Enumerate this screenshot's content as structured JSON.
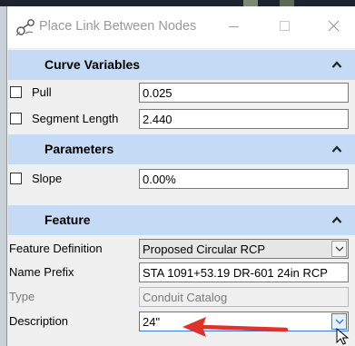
{
  "window": {
    "title": "Place Link Between Nodes"
  },
  "sections": {
    "curve": {
      "title": "Curve Variables",
      "rows": [
        {
          "label": "Pull",
          "value": "0.025"
        },
        {
          "label": "Segment Length",
          "value": "2.440"
        }
      ]
    },
    "parameters": {
      "title": "Parameters",
      "rows": [
        {
          "label": "Slope",
          "value": "0.00%"
        }
      ]
    },
    "feature": {
      "title": "Feature",
      "feature_definition": {
        "label": "Feature Definition",
        "value": "Proposed Circular RCP"
      },
      "name_prefix": {
        "label": "Name Prefix",
        "value": "STA 1091+53.19 DR-601 24in RCP"
      },
      "type": {
        "label": "Type",
        "value": "Conduit Catalog"
      },
      "description": {
        "label": "Description",
        "value": "24\""
      }
    }
  },
  "colors": {
    "section_header": "#c5daf5",
    "annotation_arrow": "#e0312b",
    "focus_border": "#3a7bd5"
  },
  "icons": [
    "node-link-tool-icon",
    "minimize-icon",
    "maximize-icon",
    "close-icon",
    "collapse-up-icon",
    "chevron-down-icon",
    "mouse-pointer-icon"
  ]
}
